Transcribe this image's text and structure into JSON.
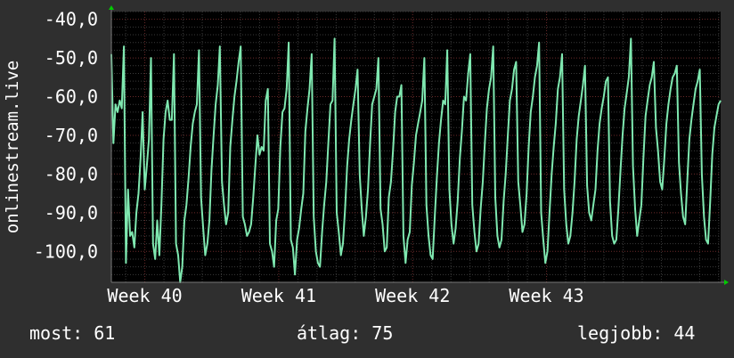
{
  "chart_data": {
    "type": "line",
    "title": "",
    "ylabel": "onlinestream.live",
    "xlabel": "",
    "y_tick_labels": [
      "-40,0",
      "-50,0",
      "-60,0",
      "-70,0",
      "-80,0",
      "-90,0",
      "-100,0"
    ],
    "y_ticks": [
      -40,
      -50,
      -60,
      -70,
      -80,
      -90,
      -100
    ],
    "ylim": [
      -108,
      -38
    ],
    "x_tick_labels": [
      "Week 40",
      "Week 41",
      "Week 42",
      "Week 43"
    ],
    "x_ticks": [
      40,
      41,
      42,
      43
    ],
    "xlim": [
      39.75,
      44.3
    ],
    "grid": true,
    "colors": {
      "background": "#2f2f2f",
      "plot_background": "#000000",
      "grid_minor": "#3a3a3a",
      "grid_major": "#6a2a2a",
      "axis": "#777777",
      "arrow": "#00cc00",
      "line": "#7fe8b0",
      "text": "#ffffff"
    },
    "series": [
      {
        "values": [
          -49,
          -72,
          -62,
          -64,
          -61,
          -63,
          -47,
          -103,
          -84,
          -96,
          -95,
          -99,
          -90,
          -85,
          -76,
          -64,
          -84,
          -78,
          -71,
          -50,
          -98,
          -102,
          -92,
          -101,
          -88,
          -71,
          -64,
          -61,
          -66,
          -66,
          -49,
          -98,
          -101,
          -108,
          -104,
          -92,
          -88,
          -81,
          -73,
          -67,
          -64,
          -62,
          -48,
          -86,
          -94,
          -101,
          -98,
          -92,
          -79,
          -70,
          -62,
          -57,
          -47,
          -82,
          -88,
          -93,
          -90,
          -73,
          -66,
          -60,
          -56,
          -51,
          -47,
          -91,
          -93,
          -96,
          -95,
          -93,
          -86,
          -78,
          -70,
          -75,
          -73,
          -74,
          -61,
          -58,
          -98,
          -100,
          -104,
          -92,
          -89,
          -73,
          -64,
          -63,
          -58,
          -46,
          -97,
          -99,
          -106,
          -97,
          -94,
          -89,
          -85,
          -69,
          -63,
          -58,
          -49,
          -91,
          -100,
          -103,
          -104,
          -95,
          -88,
          -82,
          -72,
          -62,
          -61,
          -45,
          -90,
          -95,
          -101,
          -98,
          -89,
          -78,
          -71,
          -66,
          -62,
          -58,
          -53,
          -80,
          -89,
          -96,
          -91,
          -84,
          -72,
          -62,
          -60,
          -58,
          -50,
          -89,
          -93,
          -100,
          -99,
          -86,
          -82,
          -74,
          -64,
          -60,
          -60,
          -57,
          -96,
          -103,
          -97,
          -95,
          -83,
          -77,
          -70,
          -67,
          -64,
          -61,
          -50,
          -88,
          -96,
          -101,
          -102,
          -91,
          -81,
          -72,
          -66,
          -61,
          -62,
          -48,
          -84,
          -93,
          -98,
          -94,
          -87,
          -76,
          -69,
          -60,
          -61,
          -54,
          -49,
          -88,
          -95,
          -100,
          -98,
          -89,
          -82,
          -72,
          -63,
          -58,
          -55,
          -47,
          -86,
          -96,
          -99,
          -97,
          -87,
          -80,
          -70,
          -61,
          -58,
          -53,
          -51,
          -82,
          -88,
          -95,
          -93,
          -85,
          -73,
          -64,
          -60,
          -55,
          -52,
          -46,
          -90,
          -97,
          -103,
          -100,
          -90,
          -80,
          -73,
          -67,
          -58,
          -55,
          -49,
          -84,
          -93,
          -98,
          -96,
          -90,
          -82,
          -71,
          -65,
          -61,
          -57,
          -52,
          -83,
          -90,
          -92,
          -88,
          -84,
          -74,
          -67,
          -63,
          -60,
          -56,
          -55,
          -87,
          -96,
          -98,
          -97,
          -89,
          -79,
          -70,
          -63,
          -59,
          -55,
          -45,
          -78,
          -89,
          -96,
          -92,
          -88,
          -76,
          -65,
          -61,
          -57,
          -55,
          -51,
          -68,
          -74,
          -82,
          -84,
          -76,
          -67,
          -62,
          -58,
          -55,
          -54,
          -52,
          -77,
          -85,
          -91,
          -93,
          -82,
          -71,
          -66,
          -62,
          -58,
          -56,
          -53,
          -80,
          -91,
          -97,
          -98,
          -87,
          -75,
          -68,
          -65,
          -62,
          -61
        ]
      }
    ]
  },
  "stats": {
    "current": "most: 61",
    "average": "átlag: 75",
    "best": "legjobb: 44"
  }
}
